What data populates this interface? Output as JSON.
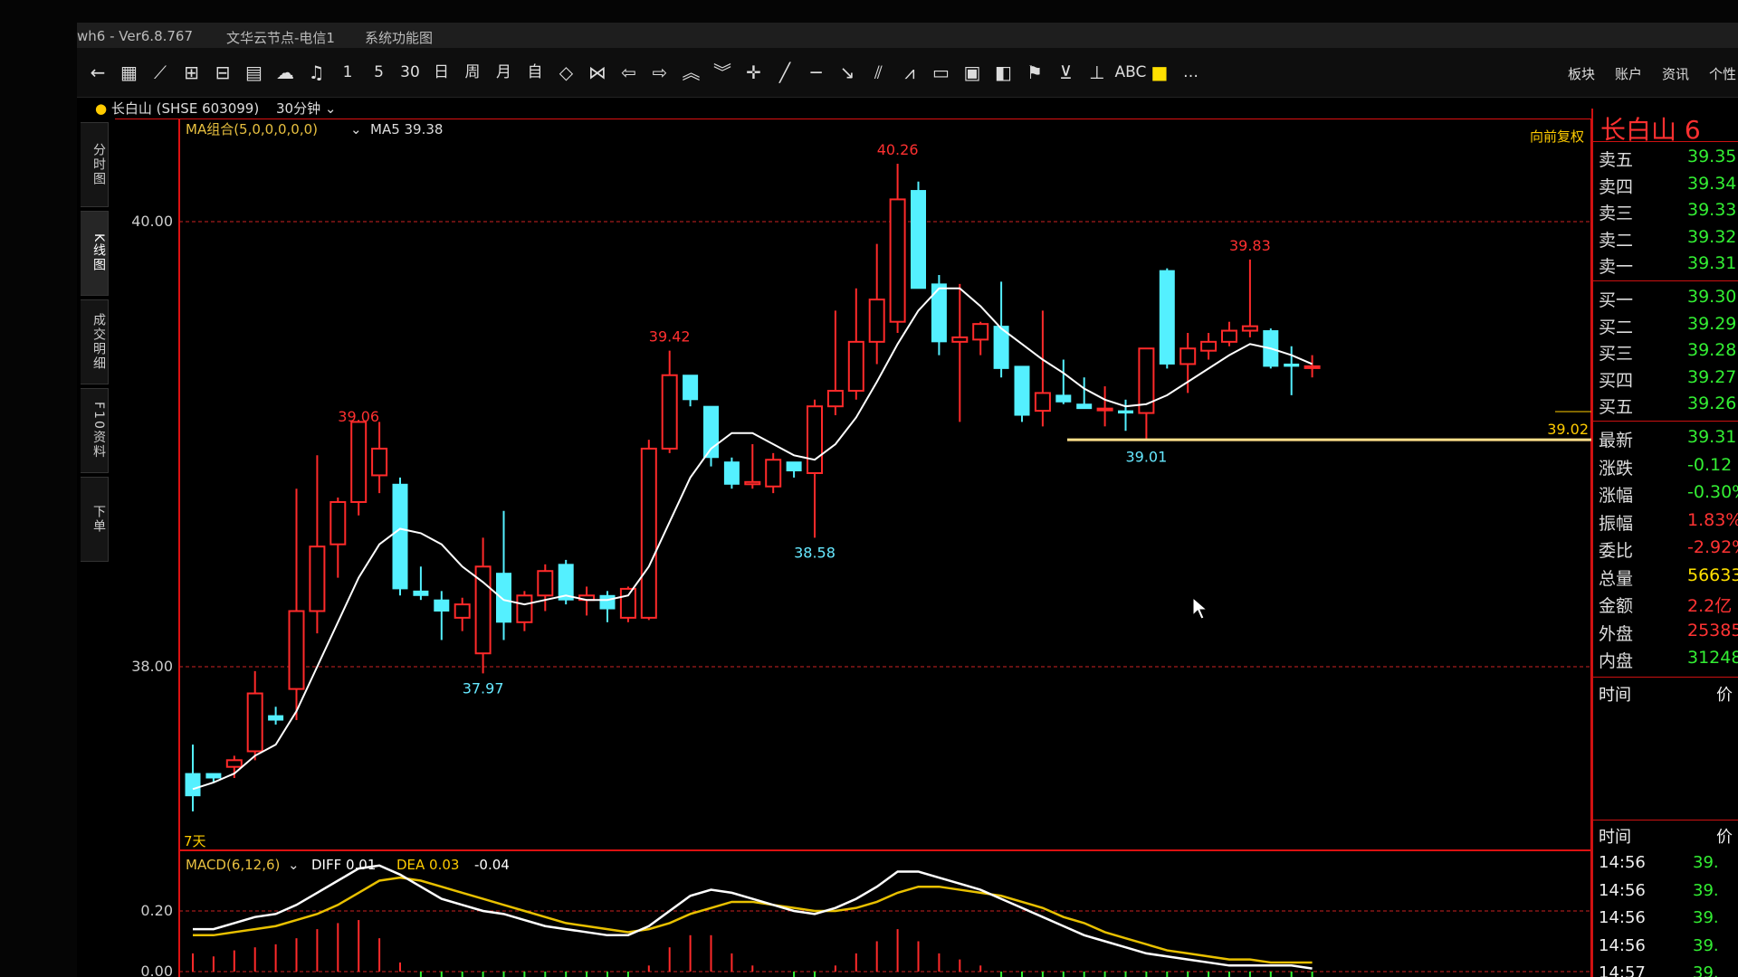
{
  "window": {
    "app_title": "wh6 - Ver6.8.767",
    "server": "文华云节点-电信1",
    "menu": "系统功能图"
  },
  "toolbar": {
    "icons": [
      "back-icon",
      "grid-icon",
      "line-icon",
      "split-icon",
      "layout-icon",
      "table-icon",
      "cloud-icon",
      "bell-icon",
      "1",
      "5",
      "30",
      "日",
      "周",
      "月",
      "自",
      "diamond-icon",
      "bowtie-icon",
      "arrow-left-icon",
      "arrow-right-icon",
      "double-up-icon",
      "double-down-icon",
      "cross-icon",
      "slash-icon",
      "dash-icon",
      "arrow-down-right-icon",
      "parallel-icon",
      "zigzag-icon",
      "rect-icon",
      "panel-icon",
      "panel2-icon",
      "flag-icon",
      "fork-icon",
      "baseline-icon",
      "ABC",
      "color-swatch-icon",
      "…"
    ],
    "right_items": [
      "板块",
      "账户",
      "资讯",
      "个性"
    ]
  },
  "stock": {
    "name": "长白山",
    "code_info": "(SHSE 603099)",
    "period": "30分钟"
  },
  "sidebar": [
    "分时图",
    "K线图",
    "成交明细",
    "F10资料",
    "下单"
  ],
  "chart": {
    "ma_label": "MA组合(5,0,0,0,0,0)",
    "ma5_label": "MA5 39.38",
    "adjust_label": "向前复权",
    "days_label": "7天",
    "price_ticks": [
      "40.00",
      "38.00"
    ],
    "support_label": "39.02",
    "high_labels": [
      "39.06",
      "39.42",
      "40.26",
      "39.83"
    ],
    "low_labels": [
      "37.97",
      "38.58",
      "39.01"
    ],
    "macd_label": "MACD(6,12,6)",
    "diff_label": "DIFF 0.01",
    "dea_label": "DEA 0.03",
    "macd_value": "-0.04",
    "macd_ticks": [
      "0.20",
      "0.00"
    ]
  },
  "chart_data": {
    "type": "candlestick",
    "interval": "30分钟",
    "ohlc": [
      [
        37.52,
        37.65,
        37.35,
        37.42
      ],
      [
        37.52,
        37.52,
        37.48,
        37.5
      ],
      [
        37.55,
        37.6,
        37.5,
        37.58
      ],
      [
        37.62,
        37.98,
        37.58,
        37.88
      ],
      [
        37.78,
        37.82,
        37.74,
        37.76
      ],
      [
        37.9,
        38.8,
        37.76,
        38.25
      ],
      [
        38.25,
        38.95,
        38.15,
        38.54
      ],
      [
        38.55,
        38.76,
        38.4,
        38.74
      ],
      [
        38.74,
        39.06,
        38.68,
        39.1
      ],
      [
        38.86,
        39.1,
        38.78,
        38.98
      ],
      [
        38.82,
        38.85,
        38.32,
        38.35
      ],
      [
        38.34,
        38.45,
        38.3,
        38.32
      ],
      [
        38.3,
        38.34,
        38.12,
        38.25
      ],
      [
        38.22,
        38.31,
        38.16,
        38.28
      ],
      [
        38.06,
        38.58,
        37.97,
        38.45
      ],
      [
        38.42,
        38.7,
        38.12,
        38.2
      ],
      [
        38.2,
        38.34,
        38.16,
        38.32
      ],
      [
        38.32,
        38.46,
        38.25,
        38.43
      ],
      [
        38.46,
        38.48,
        38.28,
        38.3
      ],
      [
        38.3,
        38.36,
        38.23,
        38.32
      ],
      [
        38.32,
        38.34,
        38.2,
        38.26
      ],
      [
        38.22,
        38.36,
        38.2,
        38.35
      ],
      [
        38.22,
        39.02,
        38.21,
        38.98
      ],
      [
        38.98,
        39.42,
        38.96,
        39.31
      ],
      [
        39.31,
        39.31,
        39.17,
        39.2
      ],
      [
        39.17,
        39.1,
        38.9,
        38.94
      ],
      [
        38.92,
        38.94,
        38.8,
        38.82
      ],
      [
        38.82,
        39.0,
        38.8,
        38.83
      ],
      [
        38.81,
        38.96,
        38.78,
        38.93
      ],
      [
        38.92,
        38.92,
        38.85,
        38.88
      ],
      [
        38.87,
        39.2,
        38.58,
        39.17
      ],
      [
        39.17,
        39.6,
        39.13,
        39.24
      ],
      [
        39.24,
        39.7,
        39.2,
        39.46
      ],
      [
        39.46,
        39.9,
        39.36,
        39.65
      ],
      [
        39.55,
        40.26,
        39.5,
        40.1
      ],
      [
        40.14,
        40.18,
        39.7,
        39.7
      ],
      [
        39.72,
        39.76,
        39.4,
        39.46
      ],
      [
        39.46,
        39.72,
        39.1,
        39.48
      ],
      [
        39.47,
        39.55,
        39.4,
        39.54
      ],
      [
        39.53,
        39.73,
        39.3,
        39.34
      ],
      [
        39.35,
        39.35,
        39.1,
        39.13
      ],
      [
        39.15,
        39.6,
        39.08,
        39.23
      ],
      [
        39.22,
        39.38,
        39.18,
        39.19
      ],
      [
        39.18,
        39.3,
        39.18,
        39.16
      ],
      [
        39.16,
        39.26,
        39.08,
        39.16
      ],
      [
        39.15,
        39.2,
        39.06,
        39.14
      ],
      [
        39.14,
        39.42,
        39.02,
        39.43
      ],
      [
        39.78,
        39.79,
        39.34,
        39.36
      ],
      [
        39.36,
        39.5,
        39.23,
        39.43
      ],
      [
        39.42,
        39.5,
        39.38,
        39.46
      ],
      [
        39.46,
        39.55,
        39.44,
        39.51
      ],
      [
        39.51,
        39.83,
        39.48,
        39.53
      ],
      [
        39.51,
        39.52,
        39.34,
        39.35
      ],
      [
        39.36,
        39.44,
        39.22,
        39.35
      ],
      [
        39.35,
        39.4,
        39.3,
        39.35
      ]
    ],
    "ma5": [
      37.45,
      37.48,
      37.52,
      37.6,
      37.65,
      37.8,
      38.0,
      38.2,
      38.4,
      38.55,
      38.62,
      38.6,
      38.55,
      38.45,
      38.38,
      38.3,
      38.28,
      38.3,
      38.32,
      38.3,
      38.3,
      38.32,
      38.45,
      38.65,
      38.85,
      38.98,
      39.05,
      39.05,
      39.0,
      38.95,
      38.93,
      39.0,
      39.12,
      39.28,
      39.45,
      39.6,
      39.7,
      39.7,
      39.62,
      39.52,
      39.45,
      39.38,
      39.32,
      39.25,
      39.2,
      39.17,
      39.18,
      39.22,
      39.28,
      39.34,
      39.4,
      39.45,
      39.43,
      39.4,
      39.36
    ],
    "price_axis_ticks": [
      38.0,
      40.0
    ],
    "highs_marked": [
      39.06,
      39.42,
      40.26,
      39.83
    ],
    "lows_marked": [
      37.97,
      38.58,
      39.01
    ],
    "support_level": 39.02,
    "macd": {
      "ticks": [
        0.0,
        0.2
      ],
      "diff": [
        0.14,
        0.14,
        0.16,
        0.18,
        0.19,
        0.22,
        0.26,
        0.3,
        0.34,
        0.35,
        0.32,
        0.28,
        0.24,
        0.22,
        0.2,
        0.19,
        0.17,
        0.15,
        0.14,
        0.13,
        0.12,
        0.12,
        0.15,
        0.2,
        0.25,
        0.27,
        0.26,
        0.24,
        0.22,
        0.2,
        0.19,
        0.21,
        0.24,
        0.28,
        0.33,
        0.33,
        0.31,
        0.29,
        0.27,
        0.24,
        0.21,
        0.18,
        0.15,
        0.12,
        0.1,
        0.08,
        0.06,
        0.05,
        0.04,
        0.03,
        0.02,
        0.02,
        0.02,
        0.02,
        0.01
      ],
      "dea": [
        0.12,
        0.12,
        0.13,
        0.14,
        0.15,
        0.17,
        0.19,
        0.22,
        0.26,
        0.3,
        0.31,
        0.3,
        0.28,
        0.26,
        0.24,
        0.22,
        0.2,
        0.18,
        0.16,
        0.15,
        0.14,
        0.13,
        0.14,
        0.16,
        0.19,
        0.21,
        0.23,
        0.23,
        0.22,
        0.21,
        0.2,
        0.2,
        0.21,
        0.23,
        0.26,
        0.28,
        0.28,
        0.27,
        0.26,
        0.25,
        0.23,
        0.21,
        0.18,
        0.16,
        0.13,
        0.11,
        0.09,
        0.07,
        0.06,
        0.05,
        0.04,
        0.04,
        0.03,
        0.03,
        0.03
      ],
      "hist": [
        0.06,
        0.05,
        0.07,
        0.08,
        0.09,
        0.11,
        0.14,
        0.16,
        0.17,
        0.11,
        0.03,
        -0.04,
        -0.08,
        -0.08,
        -0.08,
        -0.07,
        -0.06,
        -0.06,
        -0.04,
        -0.04,
        -0.04,
        -0.02,
        0.02,
        0.08,
        0.12,
        0.12,
        0.06,
        0.02,
        0.0,
        -0.02,
        -0.02,
        0.02,
        0.06,
        0.1,
        0.14,
        0.1,
        0.06,
        0.04,
        0.02,
        -0.02,
        -0.04,
        -0.06,
        -0.06,
        -0.08,
        -0.06,
        -0.06,
        -0.06,
        -0.04,
        -0.04,
        -0.04,
        -0.04,
        -0.04,
        -0.02,
        -0.02,
        -0.04
      ]
    }
  },
  "quote": {
    "title": "长白山 6",
    "asks": [
      [
        "卖五",
        "39.35"
      ],
      [
        "卖四",
        "39.34"
      ],
      [
        "卖三",
        "39.33"
      ],
      [
        "卖二",
        "39.32"
      ],
      [
        "卖一",
        "39.31"
      ]
    ],
    "bids": [
      [
        "买一",
        "39.30"
      ],
      [
        "买二",
        "39.29"
      ],
      [
        "买三",
        "39.28"
      ],
      [
        "买四",
        "39.27"
      ],
      [
        "买五",
        "39.26"
      ]
    ],
    "stats": [
      [
        "最新",
        "39.31",
        "green"
      ],
      [
        "涨跌",
        "-0.12",
        "green"
      ],
      [
        "涨幅",
        "-0.30%",
        "green"
      ],
      [
        "振幅",
        "1.83%",
        "red"
      ],
      [
        "委比",
        "-2.92%",
        "red"
      ],
      [
        "总量",
        "56633",
        "yellow"
      ],
      [
        "金额",
        "2.2亿",
        "red"
      ],
      [
        "外盘",
        "25385",
        "red"
      ],
      [
        "内盘",
        "31248",
        "green"
      ]
    ],
    "time_header": [
      "时间",
      "价"
    ],
    "ticks": [
      [
        "14:56",
        "39."
      ],
      [
        "14:56",
        "39."
      ],
      [
        "14:56",
        "39."
      ],
      [
        "14:56",
        "39."
      ],
      [
        "14:57",
        "39."
      ]
    ]
  }
}
